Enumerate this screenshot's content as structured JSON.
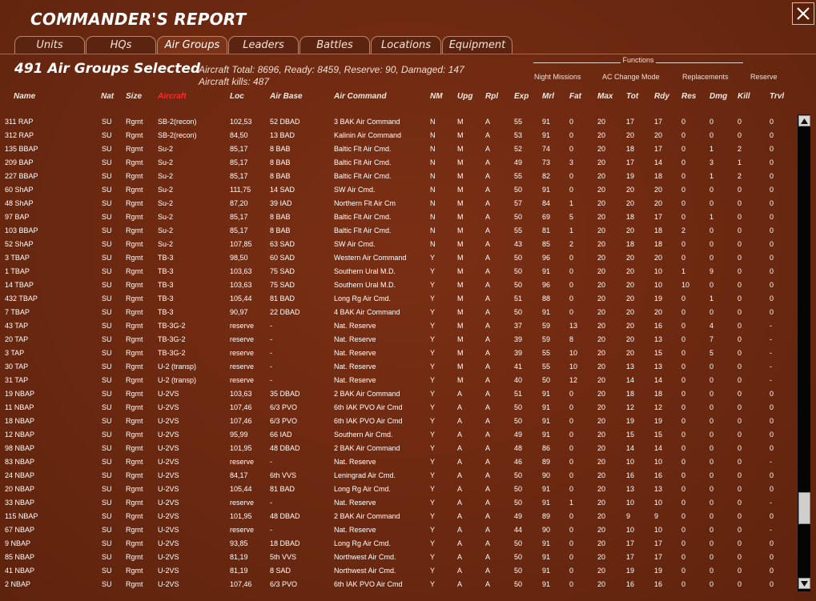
{
  "window": {
    "title": "COMMANDER'S REPORT"
  },
  "tabs": [
    "Units",
    "HQs",
    "Air Groups",
    "Leaders",
    "Battles",
    "Locations",
    "Equipment"
  ],
  "active_tab": "Air Groups",
  "summary": {
    "selected": "491 Air Groups Selected",
    "line1": "Aircraft Total: 8696, Ready: 8459, Reserve: 90, Damaged: 147",
    "line2": "Aircraft kills: 487"
  },
  "functions": {
    "label": "Functions",
    "items": [
      "Night Missions",
      "AC Change Mode",
      "Replacements",
      "Reserve"
    ]
  },
  "columns": [
    "Name",
    "Nat",
    "Size",
    "Aircraft",
    "Loc",
    "Air Base",
    "Air Command",
    "NM",
    "Upg",
    "Rpl",
    "Exp",
    "Mrl",
    "Fat",
    "Max",
    "Tot",
    "Rdy",
    "Res",
    "Dmg",
    "Kill",
    "Trvl"
  ],
  "sorted_column": "Aircraft",
  "rows": [
    [
      "311 RAP",
      "SU",
      "Rgmt",
      "SB-2(recon)",
      "102,53",
      "52 DBAD",
      "3 BAK Air Command",
      "N",
      "M",
      "A",
      "55",
      "91",
      "0",
      "20",
      "17",
      "17",
      "0",
      "0",
      "0",
      "0"
    ],
    [
      "312 RAP",
      "SU",
      "Rgmt",
      "SB-2(recon)",
      "84,50",
      "13 BAD",
      "Kalinin Air Command",
      "N",
      "M",
      "A",
      "53",
      "91",
      "0",
      "20",
      "20",
      "20",
      "0",
      "0",
      "0",
      "0"
    ],
    [
      "135 BBAP",
      "SU",
      "Rgmt",
      "Su-2",
      "85,17",
      "8 BAB",
      "Baltic Flt Air Cmd.",
      "N",
      "M",
      "A",
      "52",
      "74",
      "0",
      "20",
      "18",
      "17",
      "0",
      "1",
      "2",
      "0"
    ],
    [
      "209 BAP",
      "SU",
      "Rgmt",
      "Su-2",
      "85,17",
      "8 BAB",
      "Baltic Flt Air Cmd.",
      "N",
      "M",
      "A",
      "49",
      "73",
      "3",
      "20",
      "17",
      "14",
      "0",
      "3",
      "1",
      "0"
    ],
    [
      "227 BBAP",
      "SU",
      "Rgmt",
      "Su-2",
      "85,17",
      "8 BAB",
      "Baltic Flt Air Cmd.",
      "N",
      "M",
      "A",
      "55",
      "82",
      "0",
      "20",
      "19",
      "18",
      "0",
      "1",
      "2",
      "0"
    ],
    [
      "60 ShAP",
      "SU",
      "Rgmt",
      "Su-2",
      "111,75",
      "14 SAD",
      "SW Air Cmd.",
      "N",
      "M",
      "A",
      "50",
      "91",
      "0",
      "20",
      "20",
      "20",
      "0",
      "0",
      "0",
      "0"
    ],
    [
      "48 ShAP",
      "SU",
      "Rgmt",
      "Su-2",
      "87,20",
      "39 IAD",
      "Northern Flt Air Cm",
      "N",
      "M",
      "A",
      "57",
      "84",
      "1",
      "20",
      "20",
      "20",
      "0",
      "0",
      "0",
      "0"
    ],
    [
      "97 BAP",
      "SU",
      "Rgmt",
      "Su-2",
      "85,17",
      "8 BAB",
      "Baltic Flt Air Cmd.",
      "N",
      "M",
      "A",
      "50",
      "69",
      "5",
      "20",
      "18",
      "17",
      "0",
      "1",
      "0",
      "0"
    ],
    [
      "103 BBAP",
      "SU",
      "Rgmt",
      "Su-2",
      "85,17",
      "8 BAB",
      "Baltic Flt Air Cmd.",
      "N",
      "M",
      "A",
      "55",
      "81",
      "1",
      "20",
      "20",
      "18",
      "2",
      "0",
      "0",
      "0"
    ],
    [
      "52 ShAP",
      "SU",
      "Rgmt",
      "Su-2",
      "107,85",
      "63 SAD",
      "SW Air Cmd.",
      "N",
      "M",
      "A",
      "43",
      "85",
      "2",
      "20",
      "18",
      "18",
      "0",
      "0",
      "0",
      "0"
    ],
    [
      "3 TBAP",
      "SU",
      "Rgmt",
      "TB-3",
      "98,50",
      "60 SAD",
      "Western Air Command",
      "Y",
      "M",
      "A",
      "50",
      "96",
      "0",
      "20",
      "20",
      "20",
      "0",
      "0",
      "0",
      "0"
    ],
    [
      "1 TBAP",
      "SU",
      "Rgmt",
      "TB-3",
      "103,63",
      "75 SAD",
      "Southern Ural M.D.",
      "Y",
      "M",
      "A",
      "50",
      "91",
      "0",
      "20",
      "20",
      "10",
      "1",
      "9",
      "0",
      "0"
    ],
    [
      "14 TBAP",
      "SU",
      "Rgmt",
      "TB-3",
      "103,63",
      "75 SAD",
      "Southern Ural M.D.",
      "Y",
      "M",
      "A",
      "50",
      "96",
      "0",
      "20",
      "20",
      "10",
      "10",
      "0",
      "0",
      "0"
    ],
    [
      "432 TBAP",
      "SU",
      "Rgmt",
      "TB-3",
      "105,44",
      "81 BAD",
      "Long Rg Air Cmd.",
      "Y",
      "M",
      "A",
      "51",
      "88",
      "0",
      "20",
      "20",
      "19",
      "0",
      "1",
      "0",
      "0"
    ],
    [
      "7 TBAP",
      "SU",
      "Rgmt",
      "TB-3",
      "90,97",
      "22 DBAD",
      "4 BAK Air Command",
      "Y",
      "M",
      "A",
      "50",
      "91",
      "0",
      "20",
      "20",
      "20",
      "0",
      "0",
      "0",
      "0"
    ],
    [
      "43 TAP",
      "SU",
      "Rgmt",
      "TB-3G-2",
      "reserve",
      "-",
      "Nat. Reserve",
      "Y",
      "M",
      "A",
      "37",
      "59",
      "13",
      "20",
      "20",
      "16",
      "0",
      "4",
      "0",
      "-"
    ],
    [
      "20 TAP",
      "SU",
      "Rgmt",
      "TB-3G-2",
      "reserve",
      "-",
      "Nat. Reserve",
      "Y",
      "M",
      "A",
      "39",
      "59",
      "8",
      "20",
      "20",
      "13",
      "0",
      "7",
      "0",
      "-"
    ],
    [
      "3 TAP",
      "SU",
      "Rgmt",
      "TB-3G-2",
      "reserve",
      "-",
      "Nat. Reserve",
      "Y",
      "M",
      "A",
      "39",
      "55",
      "10",
      "20",
      "20",
      "15",
      "0",
      "5",
      "0",
      "-"
    ],
    [
      "30 TAP",
      "SU",
      "Rgmt",
      "U-2 (transp)",
      "reserve",
      "-",
      "Nat. Reserve",
      "Y",
      "M",
      "A",
      "41",
      "55",
      "10",
      "20",
      "13",
      "13",
      "0",
      "0",
      "0",
      "-"
    ],
    [
      "31 TAP",
      "SU",
      "Rgmt",
      "U-2 (transp)",
      "reserve",
      "-",
      "Nat. Reserve",
      "Y",
      "M",
      "A",
      "40",
      "50",
      "12",
      "20",
      "14",
      "14",
      "0",
      "0",
      "0",
      "-"
    ],
    [
      "19 NBAP",
      "SU",
      "Rgmt",
      "U-2VS",
      "103,63",
      "35 DBAD",
      "2 BAK Air Command",
      "Y",
      "A",
      "A",
      "51",
      "91",
      "0",
      "20",
      "18",
      "18",
      "0",
      "0",
      "0",
      "0"
    ],
    [
      "11 NBAP",
      "SU",
      "Rgmt",
      "U-2VS",
      "107,46",
      "6/3 PVO",
      "6th IAK PVO Air Cmd",
      "Y",
      "A",
      "A",
      "50",
      "91",
      "0",
      "20",
      "12",
      "12",
      "0",
      "0",
      "0",
      "0"
    ],
    [
      "18 NBAP",
      "SU",
      "Rgmt",
      "U-2VS",
      "107,46",
      "6/3 PVO",
      "6th IAK PVO Air Cmd",
      "Y",
      "A",
      "A",
      "50",
      "91",
      "0",
      "20",
      "19",
      "19",
      "0",
      "0",
      "0",
      "0"
    ],
    [
      "12 NBAP",
      "SU",
      "Rgmt",
      "U-2VS",
      "95,99",
      "66 IAD",
      "Southern Air Cmd.",
      "Y",
      "A",
      "A",
      "49",
      "91",
      "0",
      "20",
      "15",
      "15",
      "0",
      "0",
      "0",
      "0"
    ],
    [
      "98 NBAP",
      "SU",
      "Rgmt",
      "U-2VS",
      "101,95",
      "48 DBAD",
      "2 BAK Air Command",
      "Y",
      "A",
      "A",
      "48",
      "86",
      "0",
      "20",
      "14",
      "14",
      "0",
      "0",
      "0",
      "0"
    ],
    [
      "83 NBAP",
      "SU",
      "Rgmt",
      "U-2VS",
      "reserve",
      "-",
      "Nat. Reserve",
      "Y",
      "A",
      "A",
      "46",
      "89",
      "0",
      "20",
      "10",
      "10",
      "0",
      "0",
      "0",
      "-"
    ],
    [
      "24 NBAP",
      "SU",
      "Rgmt",
      "U-2VS",
      "84,17",
      "6th VVS",
      "Leningrad Air Cmd.",
      "Y",
      "A",
      "A",
      "50",
      "90",
      "0",
      "20",
      "16",
      "16",
      "0",
      "0",
      "0",
      "0"
    ],
    [
      "20 NBAP",
      "SU",
      "Rgmt",
      "U-2VS",
      "105,44",
      "81 BAD",
      "Long Rg Air Cmd.",
      "Y",
      "A",
      "A",
      "50",
      "91",
      "0",
      "20",
      "13",
      "13",
      "0",
      "0",
      "0",
      "0"
    ],
    [
      "33 NBAP",
      "SU",
      "Rgmt",
      "U-2VS",
      "reserve",
      "-",
      "Nat. Reserve",
      "Y",
      "A",
      "A",
      "50",
      "91",
      "1",
      "20",
      "10",
      "10",
      "0",
      "0",
      "0",
      "-"
    ],
    [
      "115 NBAP",
      "SU",
      "Rgmt",
      "U-2VS",
      "101,95",
      "48 DBAD",
      "2 BAK Air Command",
      "Y",
      "A",
      "A",
      "49",
      "89",
      "0",
      "20",
      "9",
      "9",
      "0",
      "0",
      "0",
      "0"
    ],
    [
      "67 NBAP",
      "SU",
      "Rgmt",
      "U-2VS",
      "reserve",
      "-",
      "Nat. Reserve",
      "Y",
      "A",
      "A",
      "44",
      "90",
      "0",
      "20",
      "10",
      "10",
      "0",
      "0",
      "0",
      "-"
    ],
    [
      "9 NBAP",
      "SU",
      "Rgmt",
      "U-2VS",
      "93,85",
      "18 DBAD",
      "Long Rg Air Cmd.",
      "Y",
      "A",
      "A",
      "50",
      "91",
      "0",
      "20",
      "17",
      "17",
      "0",
      "0",
      "0",
      "0"
    ],
    [
      "85 NBAP",
      "SU",
      "Rgmt",
      "U-2VS",
      "81,19",
      "5th VVS",
      "Northwest Air Cmd.",
      "Y",
      "A",
      "A",
      "50",
      "91",
      "0",
      "20",
      "17",
      "17",
      "0",
      "0",
      "0",
      "0"
    ],
    [
      "41 NBAP",
      "SU",
      "Rgmt",
      "U-2VS",
      "81,19",
      "8 SAD",
      "Northwest Air Cmd.",
      "Y",
      "A",
      "A",
      "50",
      "91",
      "0",
      "20",
      "19",
      "19",
      "0",
      "0",
      "0",
      "0"
    ],
    [
      "2 NBAP",
      "SU",
      "Rgmt",
      "U-2VS",
      "107,46",
      "6/3 PVO",
      "6th IAK PVO Air Cmd",
      "Y",
      "A",
      "A",
      "50",
      "91",
      "0",
      "20",
      "16",
      "16",
      "0",
      "0",
      "0",
      "0"
    ]
  ],
  "scroll_icons": {
    "up": "arrow-up-icon",
    "down": "arrow-down-icon"
  },
  "colors": {
    "background": "#6e2a12",
    "sorted_header": "#ff2a2a",
    "text": "#ffffff"
  }
}
